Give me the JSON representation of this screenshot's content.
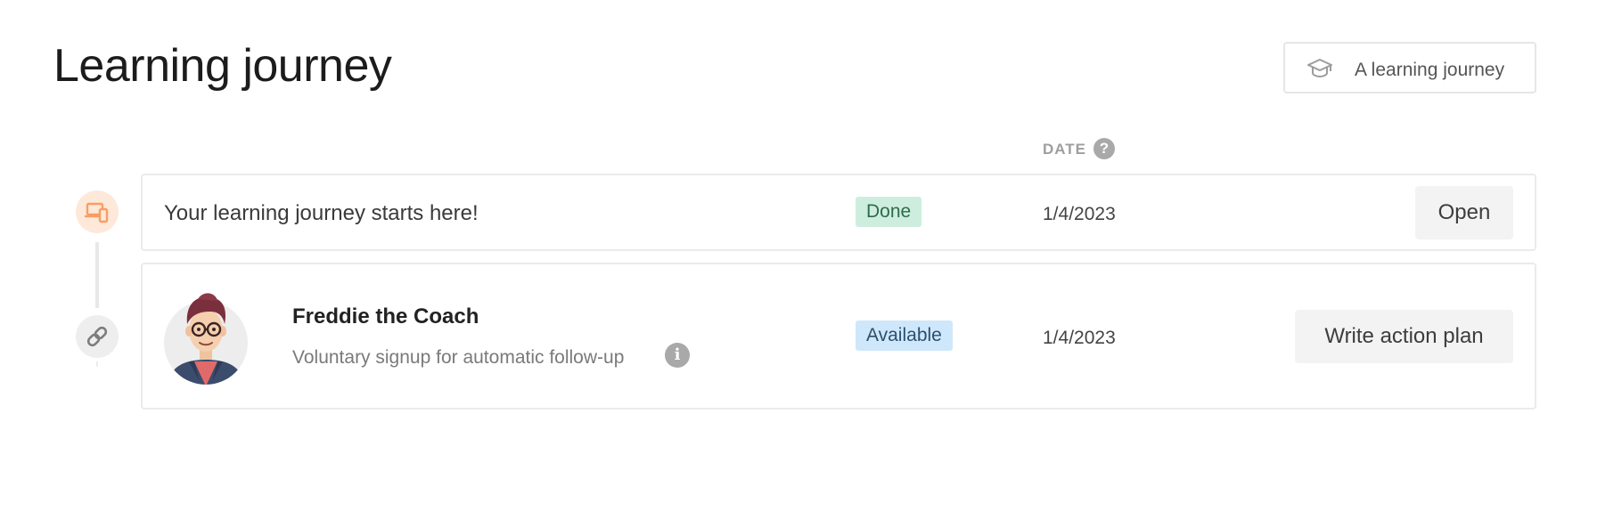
{
  "page": {
    "title": "Learning journey"
  },
  "header_button": {
    "label": "A learning journey",
    "icon": "graduation-cap-icon"
  },
  "columns": {
    "date_label": "DATE",
    "date_help_glyph": "?"
  },
  "colors": {
    "done_badge_bg": "#cdeede",
    "available_badge_bg": "#cfe7fb",
    "node_accent": "#f79e63"
  },
  "steps": [
    {
      "node_icon": "devices-icon",
      "title": "Your learning journey starts here!",
      "status": "Done",
      "date": "1/4/2023",
      "action_label": "Open"
    },
    {
      "node_icon": "link-icon",
      "avatar": "coach-avatar",
      "title": "Freddie the Coach",
      "subtitle": "Voluntary signup for automatic follow-up",
      "info_glyph": "i",
      "status": "Available",
      "date": "1/4/2023",
      "action_label": "Write action plan"
    }
  ]
}
